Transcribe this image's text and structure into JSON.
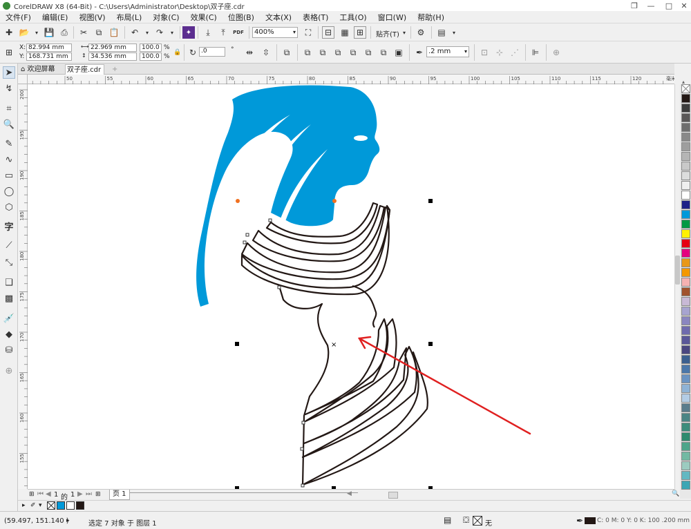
{
  "window": {
    "title": "CorelDRAW X8 (64-Bit) - C:\\Users\\Administrator\\Desktop\\双子座.cdr"
  },
  "menu": [
    "文件(F)",
    "编辑(E)",
    "视图(V)",
    "布局(L)",
    "对象(C)",
    "效果(C)",
    "位图(B)",
    "文本(X)",
    "表格(T)",
    "工具(O)",
    "窗口(W)",
    "帮助(H)"
  ],
  "toolbar": {
    "zoom_value": "400%",
    "snap_label": "贴齐(T)",
    "pdf_label": "PDF"
  },
  "properties": {
    "x_label": "X:",
    "x_value": "82.994 mm",
    "y_label": "Y:",
    "y_value": "168.731 mm",
    "width_value": "22.969 mm",
    "height_value": "34.536 mm",
    "scale_w": "100.0",
    "scale_h": "100.0",
    "percent": "%",
    "rotation_value": ".0",
    "outline_width": ".2 mm"
  },
  "doc_tabs": {
    "welcome": "欢迎屏幕",
    "document": "双子座.cdr"
  },
  "ruler_h_ticks": [
    "50",
    "55",
    "60",
    "65",
    "70",
    "75",
    "80",
    "85",
    "90",
    "95",
    "100",
    "105",
    "110",
    "115",
    "120"
  ],
  "ruler_h_unit": "毫米",
  "ruler_v_ticks": [
    "200",
    "195",
    "190",
    "185",
    "180",
    "175",
    "170",
    "165",
    "160",
    "155"
  ],
  "page_nav": {
    "page_index": "1",
    "of": "的",
    "page_total": "1",
    "page_tab": "页 1"
  },
  "status": {
    "cursor_coords": "(59.497, 151.140 )",
    "selection_text": "选定 7 对象 于 图层 1",
    "fill_none": "无",
    "outline_info": "C: 0 M: 0 Y: 0 K: 100  .200 mm"
  },
  "colors": {
    "figure_blue": "#0099d9",
    "outline_black": "#231815",
    "arrow_red": "#e02020",
    "node_orange": "#f07020"
  },
  "palette": [
    "#231815",
    "#3c3c3c",
    "#595757",
    "#6e6e6e",
    "#898989",
    "#9e9e9e",
    "#b5b5b5",
    "#c9c9c9",
    "#dcdddd",
    "#efefef",
    "#ffffff",
    "#1d2088",
    "#0099d9",
    "#009944",
    "#fff100",
    "#e60012",
    "#e4007f",
    "#e89817",
    "#f39800",
    "#f5b2b2",
    "#a0522d",
    "#c8b9d6",
    "#a7a4d0",
    "#8a86c0",
    "#6f6bae",
    "#5a5799",
    "#4a4680",
    "#3b5f8f",
    "#4b77aa",
    "#6a93c2",
    "#8fb3d6",
    "#b3cce5",
    "#5a7c8c",
    "#4b8585",
    "#3d8d7c",
    "#2e8b6e",
    "#4ea58a",
    "#73b9a3",
    "#9ccbc0",
    "#63b8c2",
    "#3ca6b4"
  ]
}
